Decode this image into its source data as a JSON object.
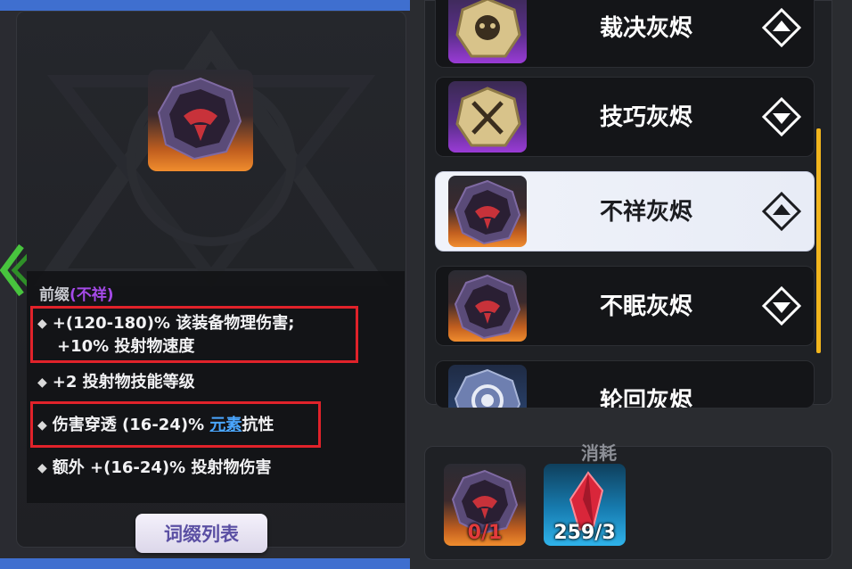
{
  "left_panel": {
    "affix_header": {
      "label": "前缀",
      "tag": "(不祥)"
    },
    "affixes": [
      {
        "line1": "+(120-180)% 该装备物理伤害;",
        "line2": "+10% 投射物速度"
      },
      {
        "text": "+2 投射物技能等级"
      },
      {
        "prefix": "伤害穿透 (16-24)% ",
        "link": "元素",
        "suffix": "抗性"
      },
      {
        "text": "额外 +(16-24)% 投射物伤害"
      }
    ],
    "affix_list_button": "词缀列表"
  },
  "list": {
    "items": [
      {
        "label": "裁决灰烬",
        "icon": "skull-ember-icon",
        "selected": false
      },
      {
        "label": "技巧灰烬",
        "icon": "crossed-blades-ember-icon",
        "selected": false
      },
      {
        "label": "不祥灰烬",
        "icon": "ominous-ember-icon",
        "selected": true
      },
      {
        "label": "不眠灰烬",
        "icon": "sleepless-ember-icon",
        "selected": false
      },
      {
        "label": "轮回灰烬",
        "icon": "swirl-ember-icon",
        "selected": false
      }
    ]
  },
  "cost": {
    "title": "消耗",
    "items": [
      {
        "icon": "ominous-ember-icon",
        "count": "0/1"
      },
      {
        "icon": "red-crystal-icon",
        "count": "259/3"
      }
    ]
  },
  "colors": {
    "accent_purple": "#a54ae8",
    "link_blue": "#4aa6ff",
    "highlight_red": "#e0222a",
    "scroll_yellow": "#f2b51d"
  }
}
